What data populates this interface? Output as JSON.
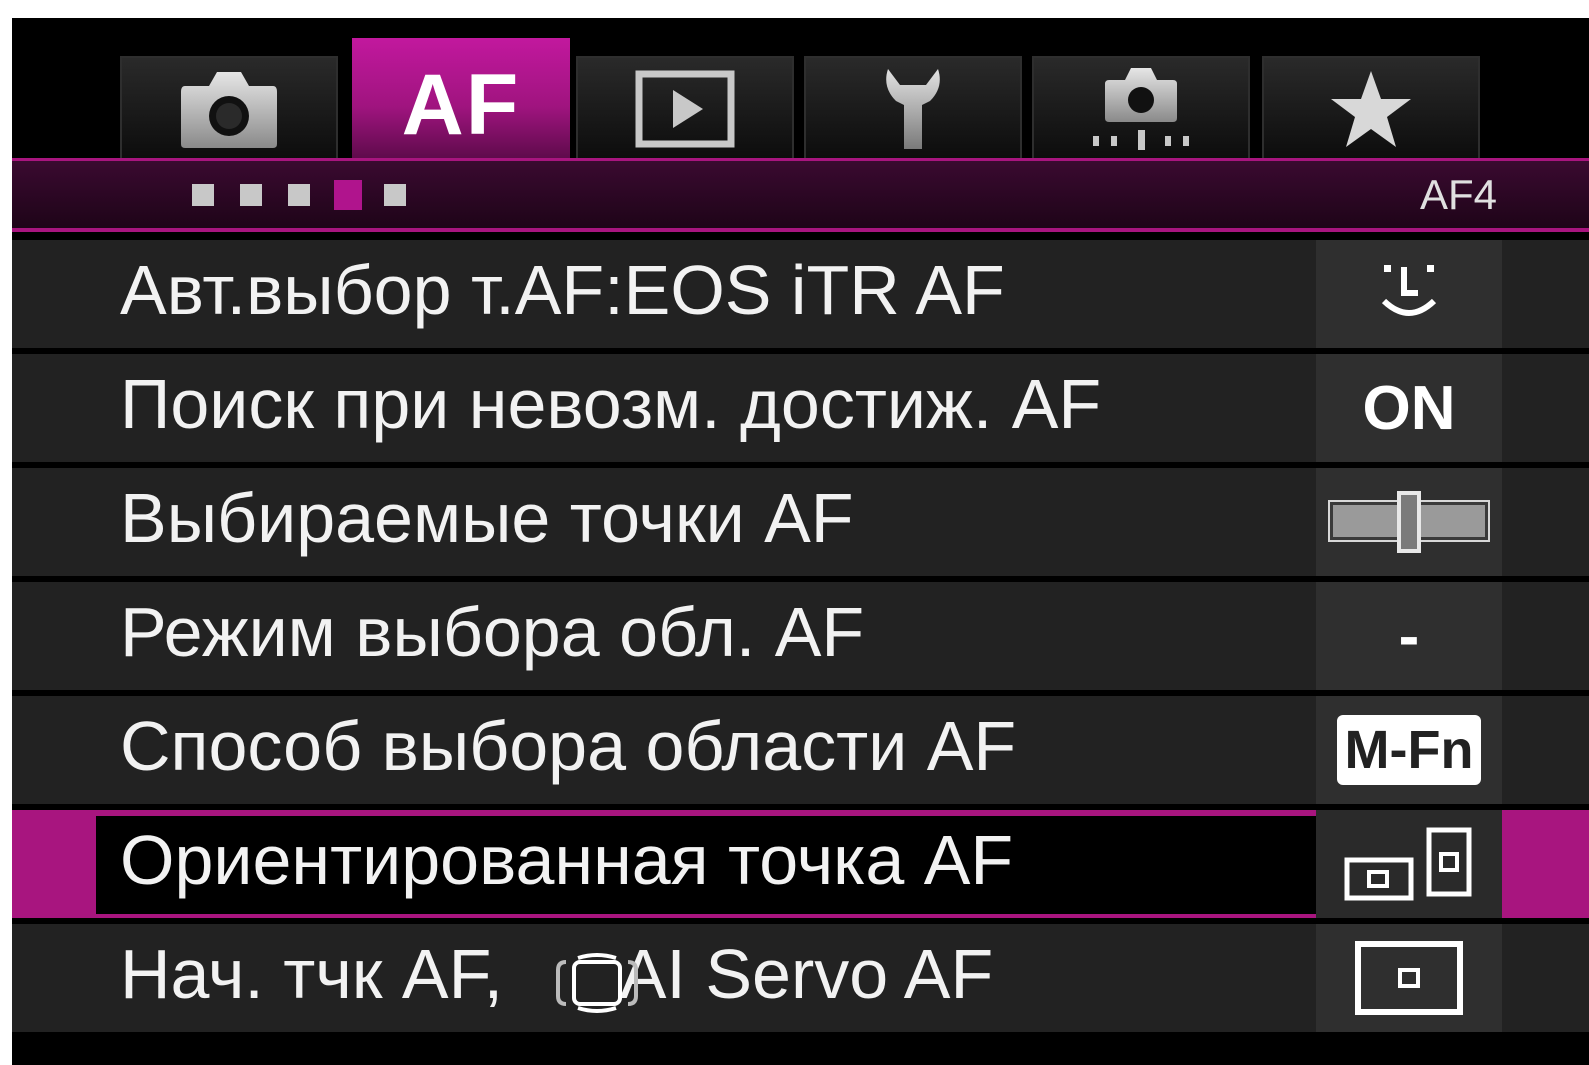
{
  "tabs": [
    {
      "id": "shooting",
      "icon": "camera-icon",
      "label": ""
    },
    {
      "id": "af",
      "icon": "",
      "label": "AF",
      "active": true
    },
    {
      "id": "playback",
      "icon": "play-icon",
      "label": ""
    },
    {
      "id": "setup",
      "icon": "wrench-icon",
      "label": ""
    },
    {
      "id": "custom",
      "icon": "custom-functions-icon",
      "label": ""
    },
    {
      "id": "mymenu",
      "icon": "star-icon",
      "label": ""
    }
  ],
  "page_indicator": {
    "count": 5,
    "active_index": 3,
    "page_id": "AF4"
  },
  "accent_color": "#a8157f",
  "menu": [
    {
      "label": "Авт.выбор т.AF:EOS iTR AF",
      "value_icon": "face-detection-icon",
      "value": ""
    },
    {
      "label": "Поиск при невозм. достиж. AF",
      "value": "ON"
    },
    {
      "label": "Выбираемые точки AF",
      "value_icon": "af-points-grid-icon",
      "value": ""
    },
    {
      "label": "Режим выбора обл. AF",
      "value": "-"
    },
    {
      "label": "Способ выбора области AF",
      "value": "M-Fn"
    },
    {
      "label": "Ориентированная точка AF",
      "value_icon": "orientation-linked-icon",
      "value": "",
      "selected": true
    },
    {
      "label": "Нач. тчк AF,      AI Servo AF",
      "value_icon": "af-point-frame-icon",
      "value": ""
    }
  ]
}
